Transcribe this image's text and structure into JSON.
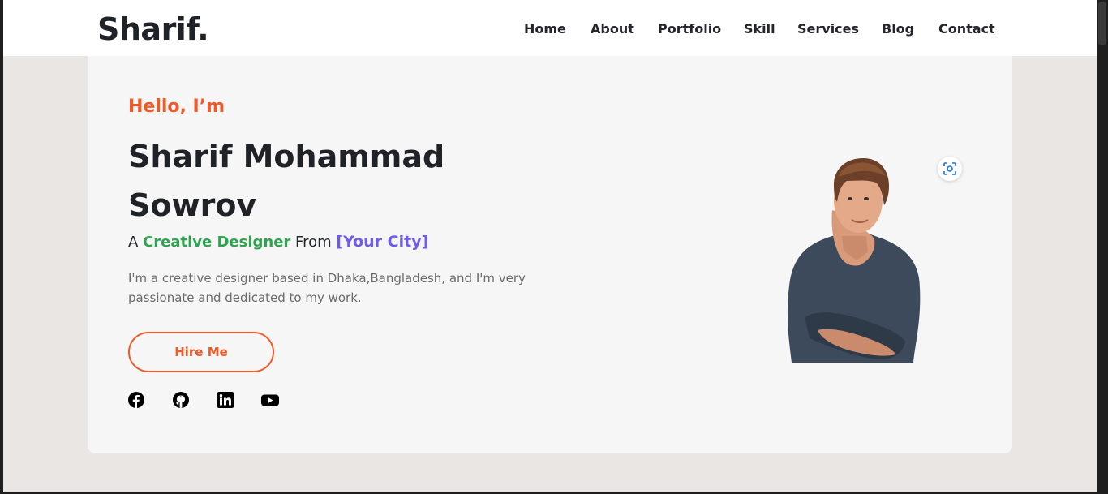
{
  "header": {
    "logo": "Sharif.",
    "nav": [
      "Home",
      "About",
      "Portfolio",
      "Skill",
      "Services",
      "Blog",
      "Contact"
    ]
  },
  "hero": {
    "greeting": "Hello, I’m",
    "name": "Sharif Mohammad Sowrov",
    "tagline": {
      "prefix": "A",
      "role": "Creative Designer",
      "middle": "From",
      "city": "[Your City]"
    },
    "bio": "I'm a creative designer based in Dhaka,Bangladesh, and I'm very passionate and dedicated to my work.",
    "cta_label": "Hire Me",
    "socials": [
      {
        "icon": "facebook-icon"
      },
      {
        "icon": "github-icon"
      },
      {
        "icon": "linkedin-icon"
      },
      {
        "icon": "youtube-icon"
      }
    ]
  },
  "colors": {
    "accent": "#f05a28",
    "role": "#2ea44f",
    "city": "#6c5ce7",
    "text": "#1f2328",
    "hero_bg": "#f6f6f6",
    "page_bg": "#e9e6e4"
  }
}
